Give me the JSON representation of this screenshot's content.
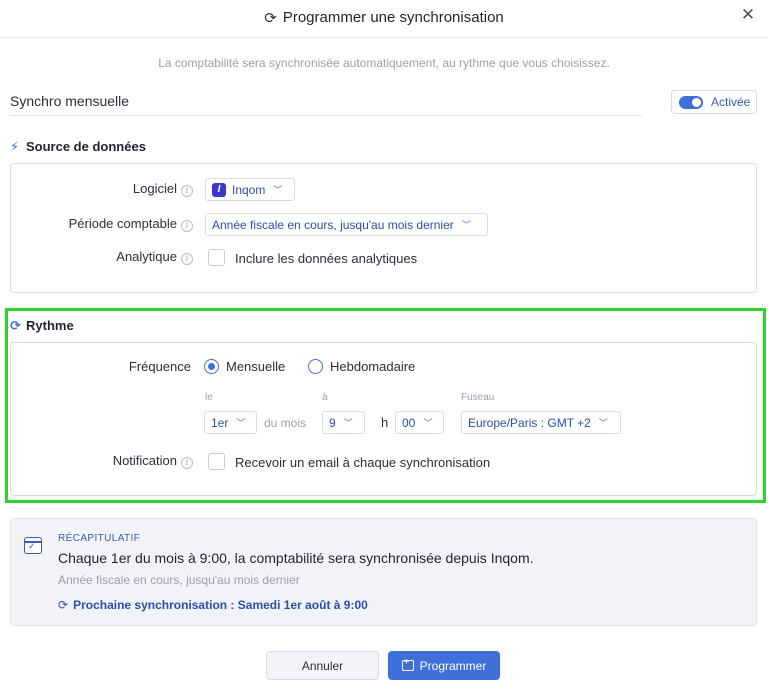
{
  "modal": {
    "title": "Programmer une synchronisation",
    "subtitle": "La comptabilité sera synchronisée automatiquement, au rythme que vous choisissez."
  },
  "sync_name": {
    "value": "Synchro mensuelle"
  },
  "toggle": {
    "label": "Activée",
    "on": true
  },
  "source": {
    "title": "Source de données",
    "logiciel_label": "Logiciel",
    "logiciel_value": "Inqom",
    "periode_label": "Période comptable",
    "periode_value": "Année fiscale en cours, jusqu'au mois dernier",
    "analytique_label": "Analytique",
    "analytique_checkbox_label": "Inclure les données analytiques"
  },
  "rythme": {
    "title": "Rythme",
    "frequence_label": "Fréquence",
    "freq_options": [
      "Mensuelle",
      "Hebdomadaire"
    ],
    "freq_selected": "Mensuelle",
    "le_label": "le",
    "day_value": "1er",
    "du_mois": "du mois",
    "a_label": "à",
    "hour_value": "9",
    "h_sep": "h",
    "minute_value": "00",
    "fuseau_label": "Fuseau",
    "fuseau_value": "Europe/Paris : GMT +2",
    "notification_label": "Notification",
    "notification_checkbox_label": "Recevoir un email à chaque synchronisation"
  },
  "recap": {
    "heading": "RÉCAPITULATIF",
    "main": "Chaque 1er du mois à 9:00, la comptabilité sera synchronisée depuis Inqom.",
    "sub": "Année fiscale en cours, jusqu'au mois dernier",
    "next": "Prochaine synchronisation : Samedi 1er août à 9:00"
  },
  "buttons": {
    "cancel": "Annuler",
    "submit": "Programmer"
  },
  "colors": {
    "accent": "#3f6fd8",
    "highlight_frame": "#2fd12f"
  }
}
